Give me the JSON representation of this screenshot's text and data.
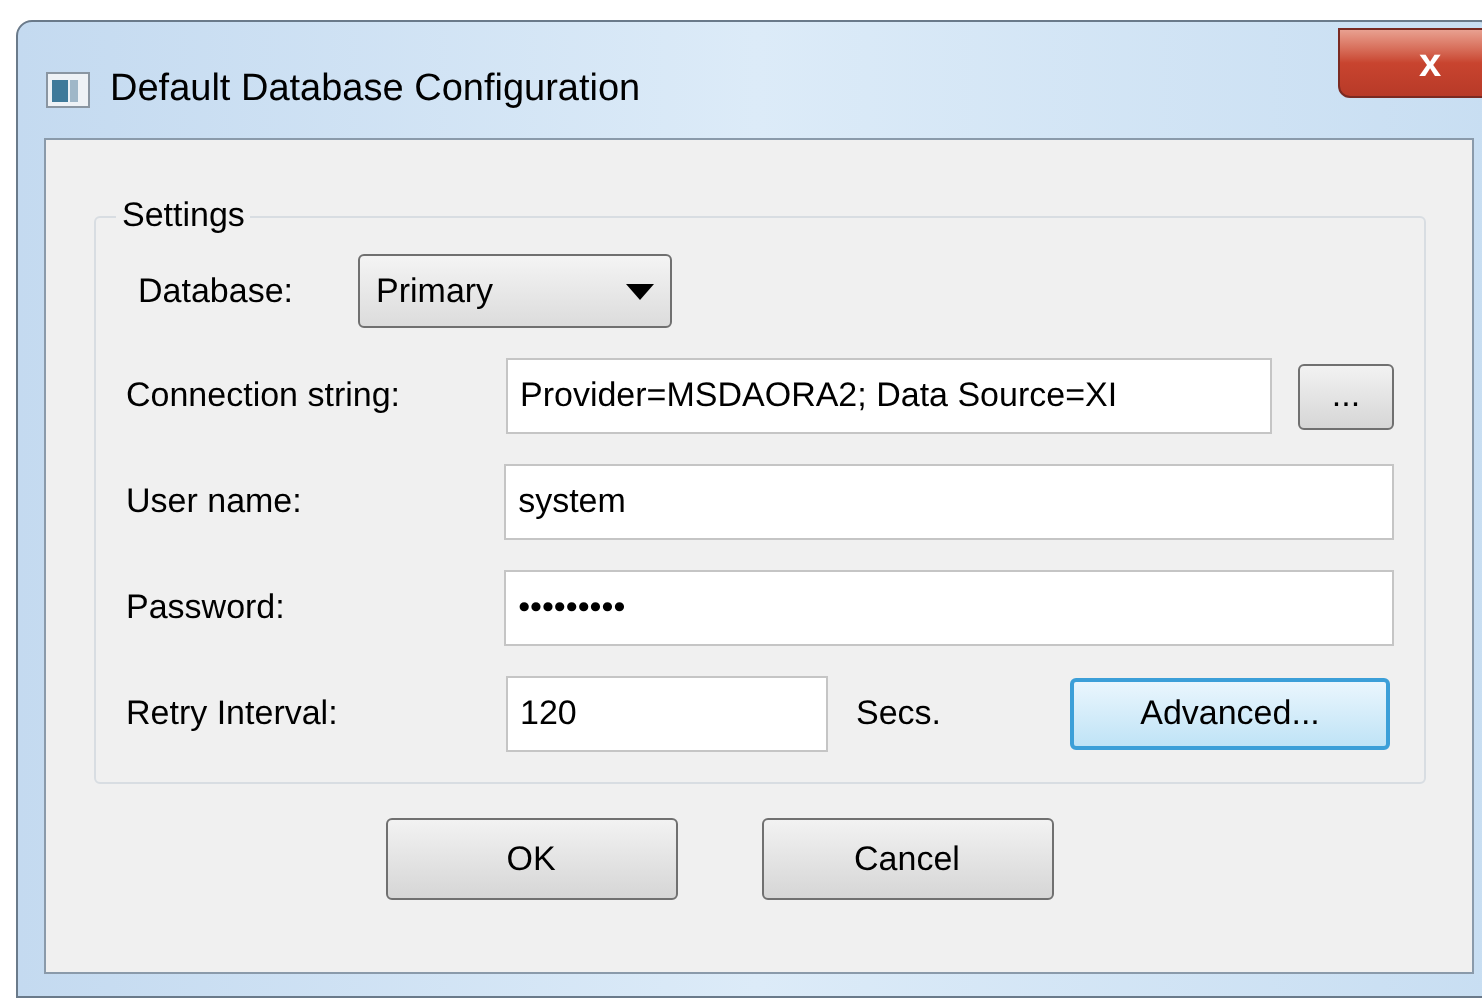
{
  "window": {
    "title": "Default Database Configuration",
    "close": "x"
  },
  "settings": {
    "title": "Settings",
    "database": {
      "label": "Database:",
      "value": "Primary"
    },
    "connection_string": {
      "label": "Connection string:",
      "value": "Provider=MSDAORA2; Data Source=XI",
      "browse": "..."
    },
    "user_name": {
      "label": "User name:",
      "value": "system"
    },
    "password": {
      "label": "Password:",
      "value": "•••••••••"
    },
    "retry_interval": {
      "label": "Retry Interval:",
      "value": "120",
      "unit": "Secs.",
      "advanced": {
        "label": "Advanced...",
        "focused": true
      }
    }
  },
  "buttons": [
    {
      "label": "OK"
    },
    {
      "label": "Cancel"
    }
  ]
}
